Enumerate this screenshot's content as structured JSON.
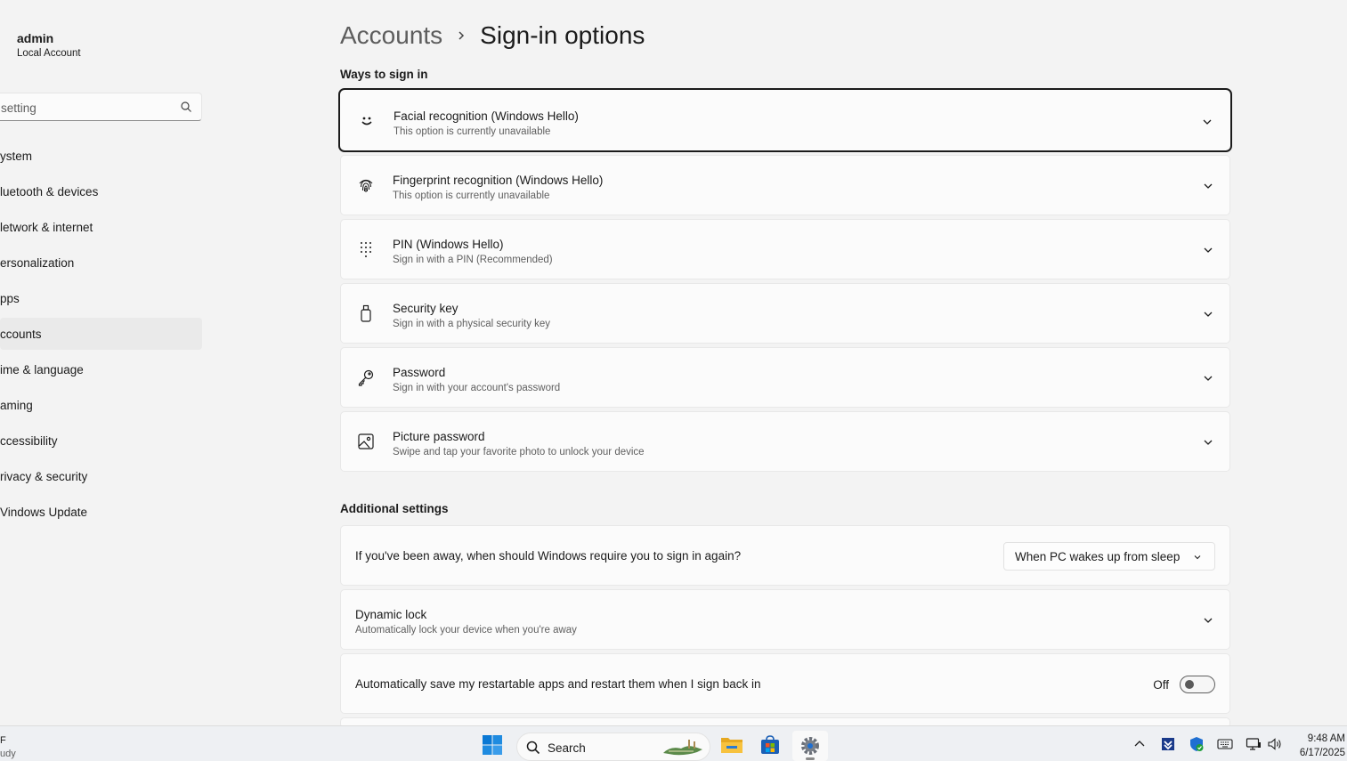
{
  "sidebar": {
    "user_name": "admin",
    "user_type": "Local Account",
    "search_placeholder": "setting",
    "items": [
      {
        "label": "ystem"
      },
      {
        "label": "luetooth & devices"
      },
      {
        "label": "letwork & internet"
      },
      {
        "label": "ersonalization"
      },
      {
        "label": "pps"
      },
      {
        "label": "ccounts"
      },
      {
        "label": "ime & language"
      },
      {
        "label": "aming"
      },
      {
        "label": "ccessibility"
      },
      {
        "label": "rivacy & security"
      },
      {
        "label": "Vindows Update"
      }
    ],
    "active_index": 5
  },
  "breadcrumb": {
    "parent": "Accounts",
    "current": "Sign-in options"
  },
  "ways_to_sign_in": {
    "title": "Ways to sign in",
    "options": [
      {
        "icon": "face-icon",
        "title": "Facial recognition (Windows Hello)",
        "subtitle": "This option is currently unavailable"
      },
      {
        "icon": "fingerprint-icon",
        "title": "Fingerprint recognition (Windows Hello)",
        "subtitle": "This option is currently unavailable"
      },
      {
        "icon": "pin-keypad-icon",
        "title": "PIN (Windows Hello)",
        "subtitle": "Sign in with a PIN (Recommended)"
      },
      {
        "icon": "usb-key-icon",
        "title": "Security key",
        "subtitle": "Sign in with a physical security key"
      },
      {
        "icon": "key-icon",
        "title": "Password",
        "subtitle": "Sign in with your account's password"
      },
      {
        "icon": "picture-icon",
        "title": "Picture password",
        "subtitle": "Swipe and tap your favorite photo to unlock your device"
      }
    ]
  },
  "additional_settings": {
    "title": "Additional settings",
    "require_signin": {
      "label": "If you've been away, when should Windows require you to sign in again?",
      "value": "When PC wakes up from sleep"
    },
    "dynamic_lock": {
      "title": "Dynamic lock",
      "subtitle": "Automatically lock your device when you're away"
    },
    "restart_apps": {
      "label": "Automatically save my restartable apps and restart them when I sign back in",
      "state": "Off"
    }
  },
  "taskbar": {
    "weather_line1": "F",
    "weather_line2": "udy",
    "search_label": "Search",
    "time": "9:48 AM",
    "date": "6/17/2025"
  },
  "colors": {
    "accent": "#0067c0",
    "background": "#f3f3f3",
    "card": "#fbfbfb"
  }
}
